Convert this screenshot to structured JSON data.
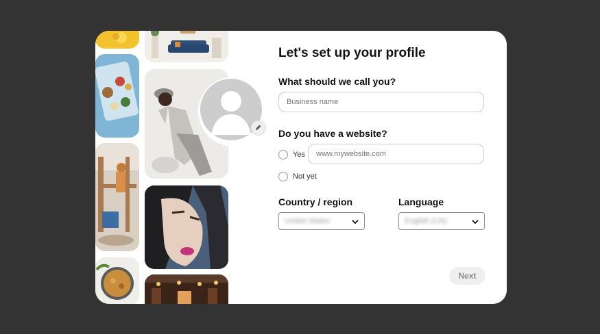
{
  "form": {
    "title": "Let's set up your profile",
    "name_label": "What should we call you?",
    "name_placeholder": "Business name",
    "website_label": "Do you have a website?",
    "yes_label": "Yes",
    "website_placeholder": "www.mywebsite.com",
    "notyet_label": "Not yet",
    "country_label": "Country / region",
    "country_value": "United States",
    "language_label": "Language",
    "language_value": "English (US)",
    "next_label": "Next"
  },
  "colors": {
    "backdrop": "#333333",
    "modal": "#ffffff",
    "input_border": "#cdcdcd",
    "next_bg": "#efefef"
  },
  "icons": [
    "default-avatar-icon",
    "pencil-icon",
    "chevron-down-icon",
    "chevron-down-icon"
  ]
}
